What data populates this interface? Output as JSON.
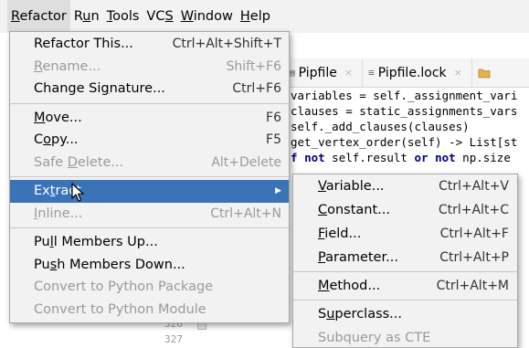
{
  "menubar": [
    {
      "mn": "R",
      "rest": "efactor",
      "active": true
    },
    {
      "pre": "R",
      "mn": "u",
      "rest": "n",
      "active": false
    },
    {
      "mn": "T",
      "rest": "ools",
      "active": false
    },
    {
      "pre": "VC",
      "mn": "S",
      "rest": "",
      "active": false
    },
    {
      "mn": "W",
      "rest": "indow",
      "active": false
    },
    {
      "mn": "H",
      "rest": "elp",
      "active": false
    }
  ],
  "tabs": [
    {
      "icon": "python-file-icon",
      "label": "Pipfile",
      "close": "×"
    },
    {
      "icon": "lock-file-icon",
      "label": "Pipfile.lock",
      "close": "×"
    }
  ],
  "code_lines": [
    "variables = self._assignment_vari",
    "clauses = static_assignments_vars",
    "self._add_clauses(clauses)",
    "",
    "get_vertex_order(self) -> List[st",
    "f not self.result or not np.size"
  ],
  "gutter": [
    "326",
    "327"
  ],
  "side_marks": [
    "t",
    "t",
    "=",
    "="
  ],
  "refactor_menu": {
    "items": [
      {
        "type": "item",
        "pre": "Refactor This...",
        "mn": "",
        "post": "",
        "shortcut": "Ctrl+Alt+Shift+T",
        "disabled": false,
        "selected": false
      },
      {
        "type": "item",
        "pre": "",
        "mn": "R",
        "post": "ename...",
        "shortcut": "Shift+F6",
        "disabled": true,
        "selected": false
      },
      {
        "type": "item",
        "pre": "Change Si",
        "mn": "g",
        "post": "nature...",
        "shortcut": "Ctrl+F6",
        "disabled": false,
        "selected": false
      },
      {
        "type": "sep"
      },
      {
        "type": "item",
        "pre": "",
        "mn": "M",
        "post": "ove...",
        "shortcut": "F6",
        "disabled": false,
        "selected": false
      },
      {
        "type": "item",
        "pre": "C",
        "mn": "o",
        "post": "py...",
        "shortcut": "F5",
        "disabled": false,
        "selected": false
      },
      {
        "type": "item",
        "pre": "Safe ",
        "mn": "D",
        "post": "elete...",
        "shortcut": "Alt+Delete",
        "disabled": true,
        "selected": false
      },
      {
        "type": "sep"
      },
      {
        "type": "item",
        "pre": "Ex",
        "mn": "t",
        "post": "ract",
        "shortcut": "",
        "disabled": false,
        "selected": true,
        "submenu": true
      },
      {
        "type": "item",
        "pre": "",
        "mn": "I",
        "post": "nline...",
        "shortcut": "Ctrl+Alt+N",
        "disabled": true,
        "selected": false
      },
      {
        "type": "sep"
      },
      {
        "type": "item",
        "pre": "Pu",
        "mn": "l",
        "post": "l Members Up...",
        "shortcut": "",
        "disabled": false,
        "selected": false
      },
      {
        "type": "item",
        "pre": "Pu",
        "mn": "s",
        "post": "h Members Down...",
        "shortcut": "",
        "disabled": false,
        "selected": false
      },
      {
        "type": "item",
        "pre": "Convert to Python Package",
        "mn": "",
        "post": "",
        "shortcut": "",
        "disabled": true,
        "selected": false
      },
      {
        "type": "item",
        "pre": "Convert to Python Module",
        "mn": "",
        "post": "",
        "shortcut": "",
        "disabled": true,
        "selected": false
      }
    ]
  },
  "extract_menu": {
    "items": [
      {
        "type": "item",
        "pre": "",
        "mn": "V",
        "post": "ariable...",
        "shortcut": "Ctrl+Alt+V",
        "disabled": false
      },
      {
        "type": "item",
        "pre": "",
        "mn": "C",
        "post": "onstant...",
        "shortcut": "Ctrl+Alt+C",
        "disabled": false
      },
      {
        "type": "item",
        "pre": "",
        "mn": "F",
        "post": "ield...",
        "shortcut": "Ctrl+Alt+F",
        "disabled": false
      },
      {
        "type": "item",
        "pre": "",
        "mn": "P",
        "post": "arameter...",
        "shortcut": "Ctrl+Alt+P",
        "disabled": false
      },
      {
        "type": "sep"
      },
      {
        "type": "item",
        "pre": "",
        "mn": "M",
        "post": "ethod...",
        "shortcut": "Ctrl+Alt+M",
        "disabled": false
      },
      {
        "type": "sep"
      },
      {
        "type": "item",
        "pre": "S",
        "mn": "u",
        "post": "perclass...",
        "shortcut": "",
        "disabled": false
      },
      {
        "type": "item",
        "pre": "Subquery as CTE",
        "mn": "",
        "post": "",
        "shortcut": "",
        "disabled": true
      }
    ]
  },
  "colors": {
    "selection": "#3b73b9",
    "menu_bg": "#f2f2f2",
    "disabled_text": "#9a9a9a"
  }
}
